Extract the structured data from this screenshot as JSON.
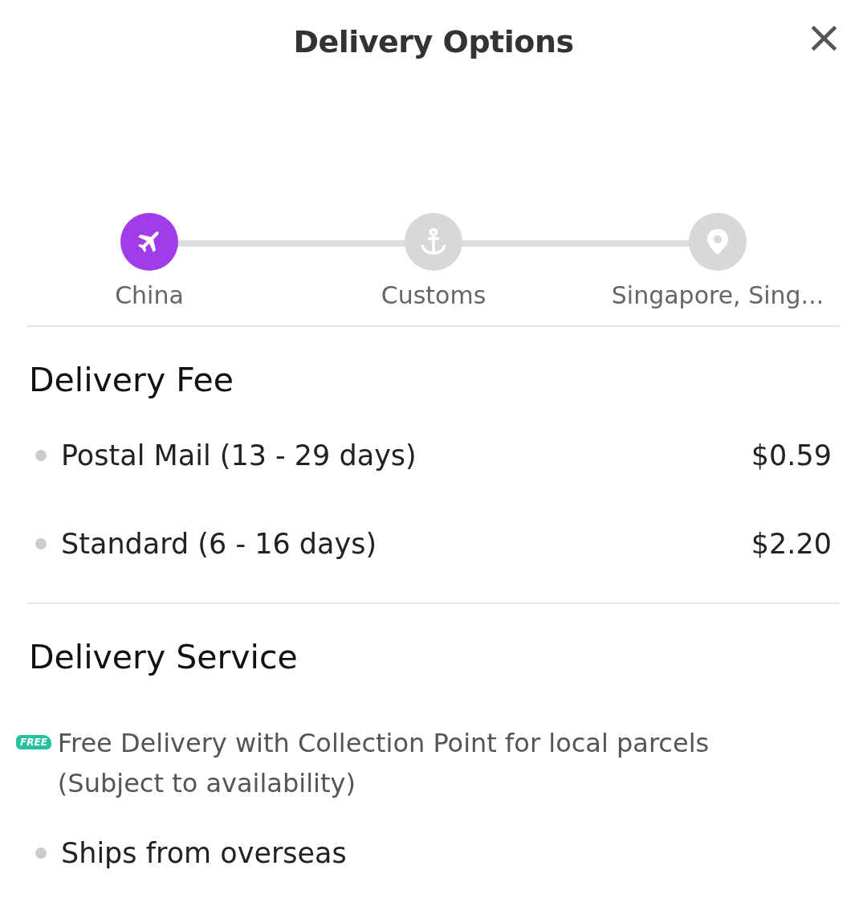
{
  "header": {
    "title": "Delivery Options",
    "close": "×"
  },
  "route": [
    {
      "kind": "plane",
      "label": "China",
      "active": true
    },
    {
      "kind": "anchor",
      "label": "Customs",
      "active": false
    },
    {
      "kind": "pin",
      "label": "Singapore, Sing...",
      "active": false
    }
  ],
  "delivery_fee": {
    "title": "Delivery Fee",
    "options": [
      {
        "label": "Postal Mail (13 - 29 days)",
        "price": "$0.59"
      },
      {
        "label": "Standard (6 - 16 days)",
        "price": "$2.20"
      }
    ]
  },
  "delivery_service": {
    "title": "Delivery Service",
    "items": [
      {
        "kind": "free",
        "badge": "FREE",
        "text": "Free Delivery with Collection Point for local parcels (Subject to availability)"
      },
      {
        "kind": "bullet",
        "text": "Ships from overseas"
      }
    ]
  }
}
